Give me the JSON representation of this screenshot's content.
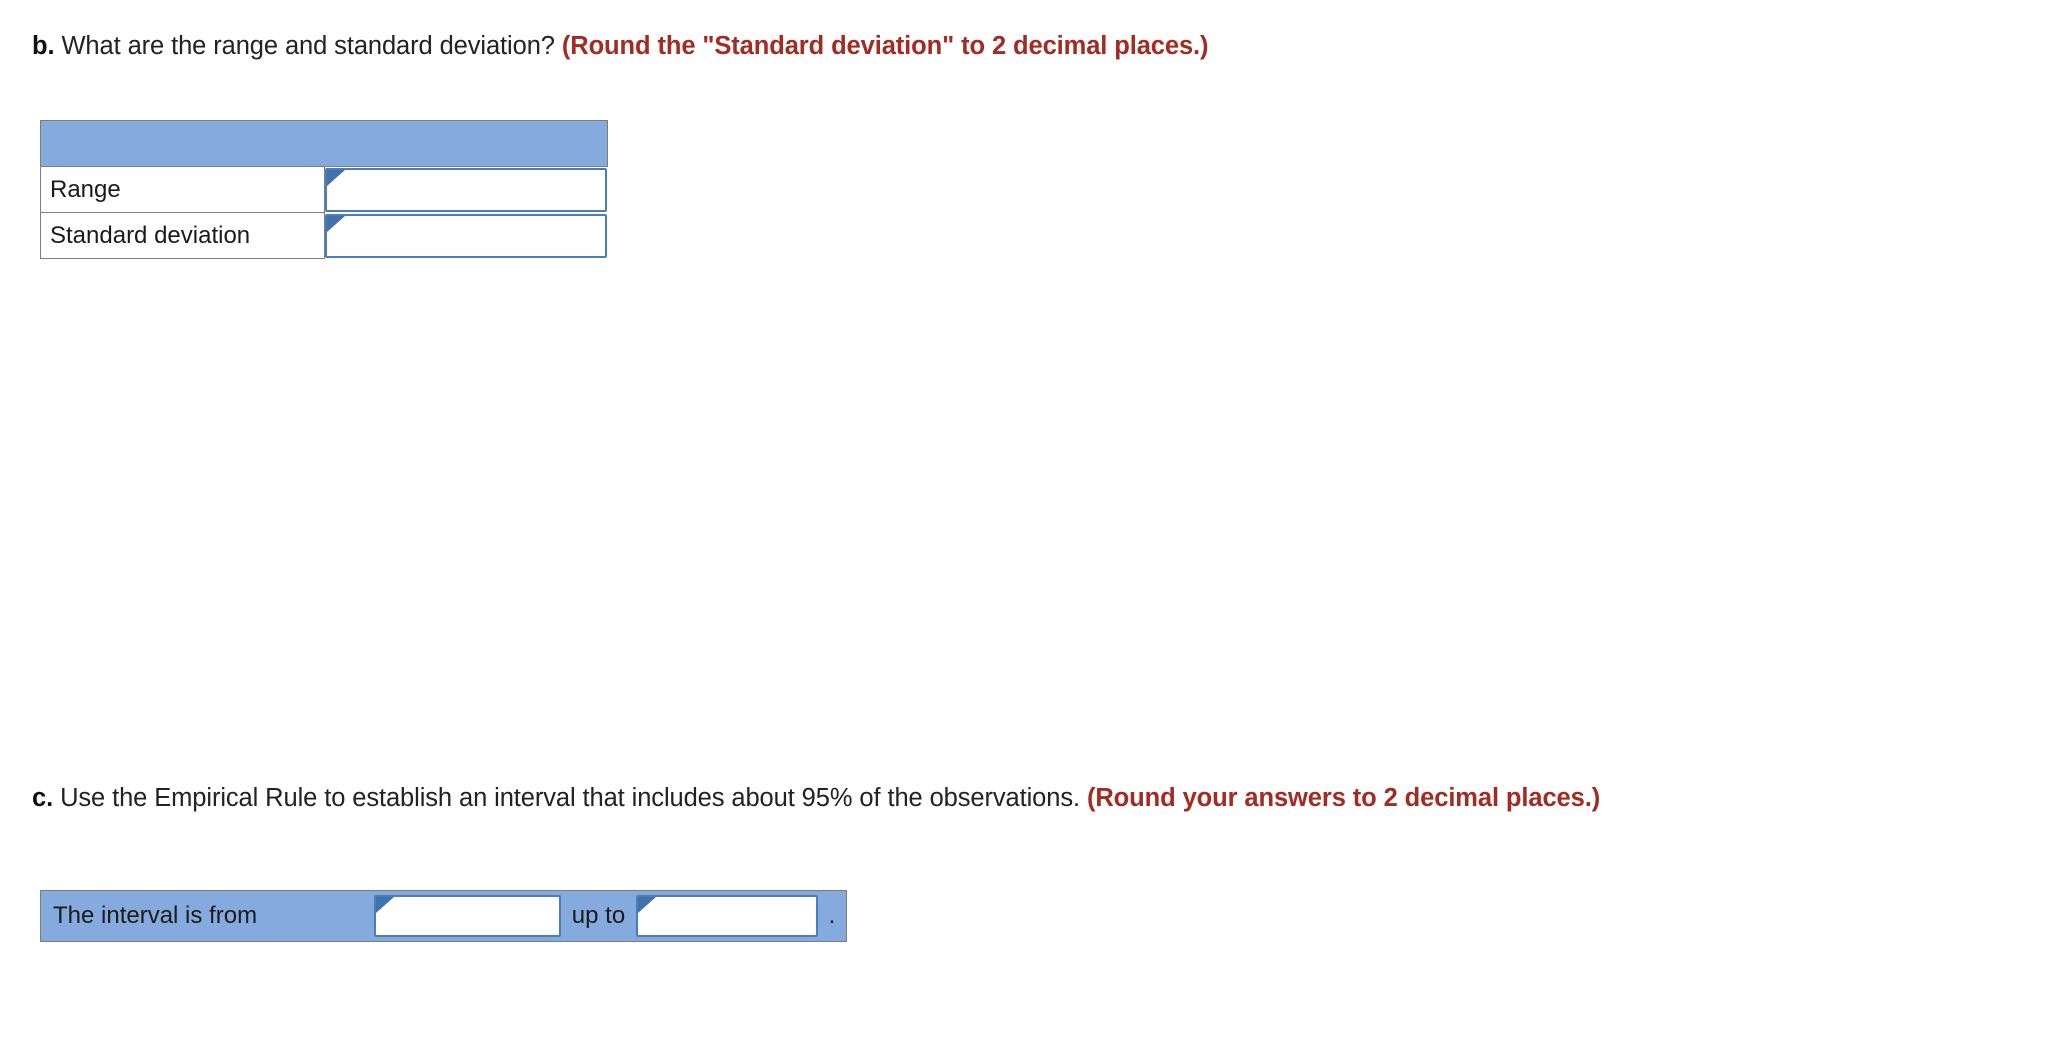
{
  "question_b": {
    "label": "b.",
    "text": "What are the range and standard deviation?",
    "note": "(Round the \"Standard deviation\" to 2 decimal places.)"
  },
  "question_c": {
    "label": "c.",
    "text": "Use the Empirical Rule to establish an interval that includes about 95% of the observations.",
    "note": "(Round your answers to 2 decimal places.)"
  },
  "answer_table": {
    "header_label": "",
    "rows": [
      {
        "label": "Range",
        "value": "",
        "placeholder": ""
      },
      {
        "label": "Standard deviation",
        "value": "",
        "placeholder": ""
      }
    ]
  },
  "interval": {
    "prefix_label": "The interval is from",
    "middle_label": "up to",
    "suffix_label": ".",
    "from_value": "",
    "to_value": "",
    "from_placeholder": "",
    "to_placeholder": ""
  },
  "colors": {
    "header_blue": "#85ABDE",
    "input_border_blue": "#4a7ebb",
    "flag_blue": "#4272ad",
    "note_red": "#a32b22",
    "cell_border_gray": "#7d7d7d"
  }
}
